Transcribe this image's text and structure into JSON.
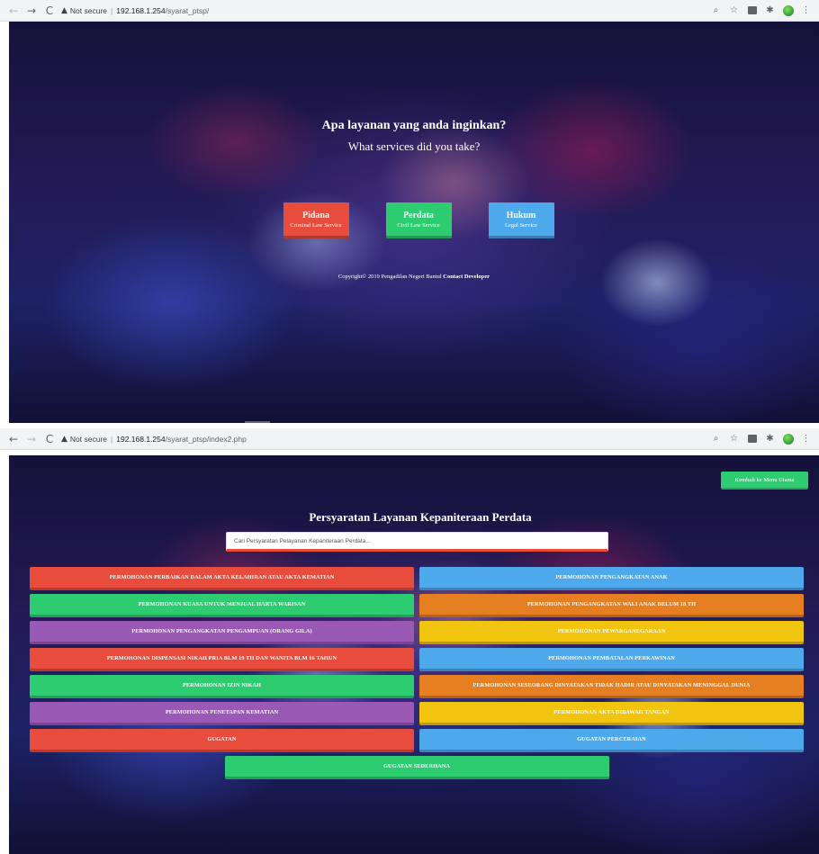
{
  "window1": {
    "url_security": "Not secure",
    "url_host": "192.168.1.254",
    "url_path": "/syarat_ptsp/",
    "question_id": "Apa layanan yang anda inginkan?",
    "question_en": "What services did you take?",
    "services": [
      {
        "title": "Pidana",
        "subtitle": "Criminal Law Service",
        "color": "#e74c3c"
      },
      {
        "title": "Perdata",
        "subtitle": "Civil Law Service",
        "color": "#2ecc71"
      },
      {
        "title": "Hukum",
        "subtitle": "Legal Service",
        "color": "#4ea9ec"
      }
    ],
    "copyright_text": "Copyright© 2019 Pengadilan Negeri Bantul",
    "copyright_link": "Contact Developer"
  },
  "window2": {
    "url_security": "Not secure",
    "url_host": "192.168.1.254",
    "url_path": "/syarat_ptsp/index2.php",
    "back_label": "Kembali ke Menu Utama",
    "title": "Persyaratan Layanan Kepaniteraan Perdata",
    "search_placeholder": "Cari Persyaratan Pelayanan Kepaniteraan Perdata...",
    "items": [
      {
        "label": "PERMOHONAN PERBAIKAN DALAM AKTA KELAHIRAN ATAU AKTA KEMATIAN",
        "color": "red"
      },
      {
        "label": "PERMOHONAN PENGANGKATAN ANAK",
        "color": "blue"
      },
      {
        "label": "PERMOHONAN KUASA UNTUK MENJUAL HARTA WARISAN",
        "color": "green"
      },
      {
        "label": "PERMOHONAN PENGANGKATAN WALI ANAK BELUM 18 TH",
        "color": "orange"
      },
      {
        "label": "PERMOHONAN PENGANGKATAN PENGAMPUAN (ORANG GILA)",
        "color": "purple"
      },
      {
        "label": "PERMOHONAN PEWARGANEGARAAN",
        "color": "yellow"
      },
      {
        "label": "PERMOHONAN DISPENSASI NIKAH PRIA BLM 19 TH DAN WANITA BLM 16 TAHUN",
        "color": "red"
      },
      {
        "label": "PERMOHONAN PEMBATALAN PERKAWINAN",
        "color": "blue"
      },
      {
        "label": "PERMOHONAN IZIN NIKAH",
        "color": "green"
      },
      {
        "label": "PERMOHONAN SESEORANG DINYATAKAN TIDAK HADIR ATAU DINYATAKAN MENINGGAL DUNIA",
        "color": "orange"
      },
      {
        "label": "PERMOHONAN PENETAPAN KEMATIAN",
        "color": "purple"
      },
      {
        "label": "PERMOHONAN AKTA DIBAWAH TANGAN",
        "color": "yellow"
      },
      {
        "label": "GUGATAN",
        "color": "red"
      },
      {
        "label": "GUGATAN PERCERAIAN",
        "color": "blue"
      },
      {
        "label": "GUGATAN SEDERHANA",
        "color": "green"
      }
    ]
  },
  "icons": [
    "back-arrow-icon",
    "forward-arrow-icon",
    "reload-icon",
    "warning-icon",
    "zoom-icon",
    "star-icon",
    "extension-icon",
    "puzzle-icon",
    "profile-icon",
    "menu-dots-icon"
  ]
}
